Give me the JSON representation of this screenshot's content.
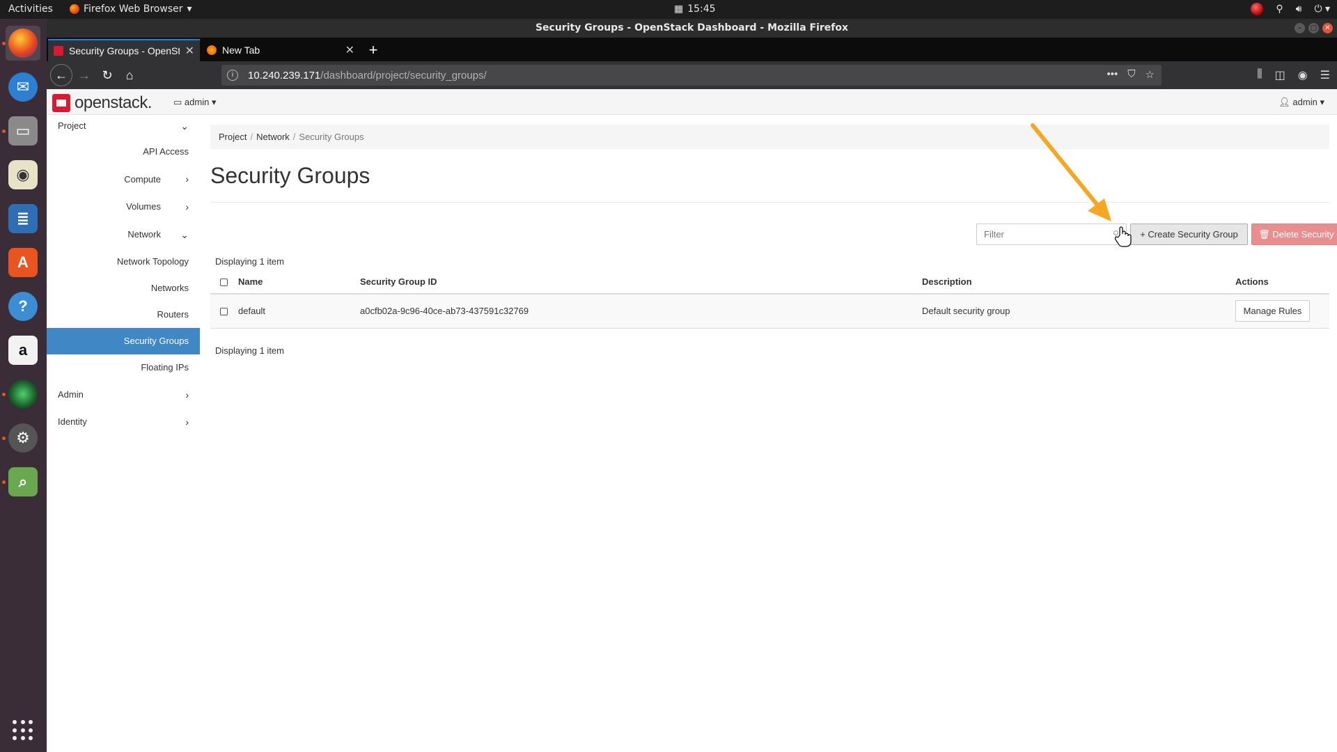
{
  "system": {
    "activities": "Activities",
    "app_name": "Firefox Web Browser",
    "clock": "15:45"
  },
  "window": {
    "title": "Security Groups - OpenStack Dashboard - Mozilla Firefox"
  },
  "browser": {
    "tabs": [
      {
        "label": "Security Groups - OpenStack Dashboard",
        "active": true
      },
      {
        "label": "New Tab",
        "active": false
      }
    ],
    "url_host": "10.240.239.171",
    "url_path": "/dashboard/project/security_groups/"
  },
  "header": {
    "logo": "openstack.",
    "project": "admin",
    "user": "admin"
  },
  "sidebar": {
    "project": "Project",
    "api_access": "API Access",
    "compute": "Compute",
    "volumes": "Volumes",
    "network": "Network",
    "network_topology": "Network Topology",
    "networks": "Networks",
    "routers": "Routers",
    "security_groups": "Security Groups",
    "floating_ips": "Floating IPs",
    "admin": "Admin",
    "identity": "Identity"
  },
  "breadcrumb": [
    "Project",
    "Network",
    "Security Groups"
  ],
  "main": {
    "title": "Security Groups",
    "filter_placeholder": "Filter",
    "create_button": "+ Create Security Group",
    "delete_button": "Delete Security Groups",
    "displaying": "Displaying 1 item",
    "columns": [
      "Name",
      "Security Group ID",
      "Description",
      "Actions"
    ],
    "rows": [
      {
        "name": "default",
        "id": "a0cfb02a-9c96-40ce-ab73-437591c32769",
        "description": "Default security group",
        "action": "Manage Rules"
      }
    ]
  },
  "colors": {
    "sidebar_active": "#3f88c5",
    "brand_red": "#da1a32",
    "danger": "#e98e8e",
    "annotation_arrow": "#f5a623"
  }
}
